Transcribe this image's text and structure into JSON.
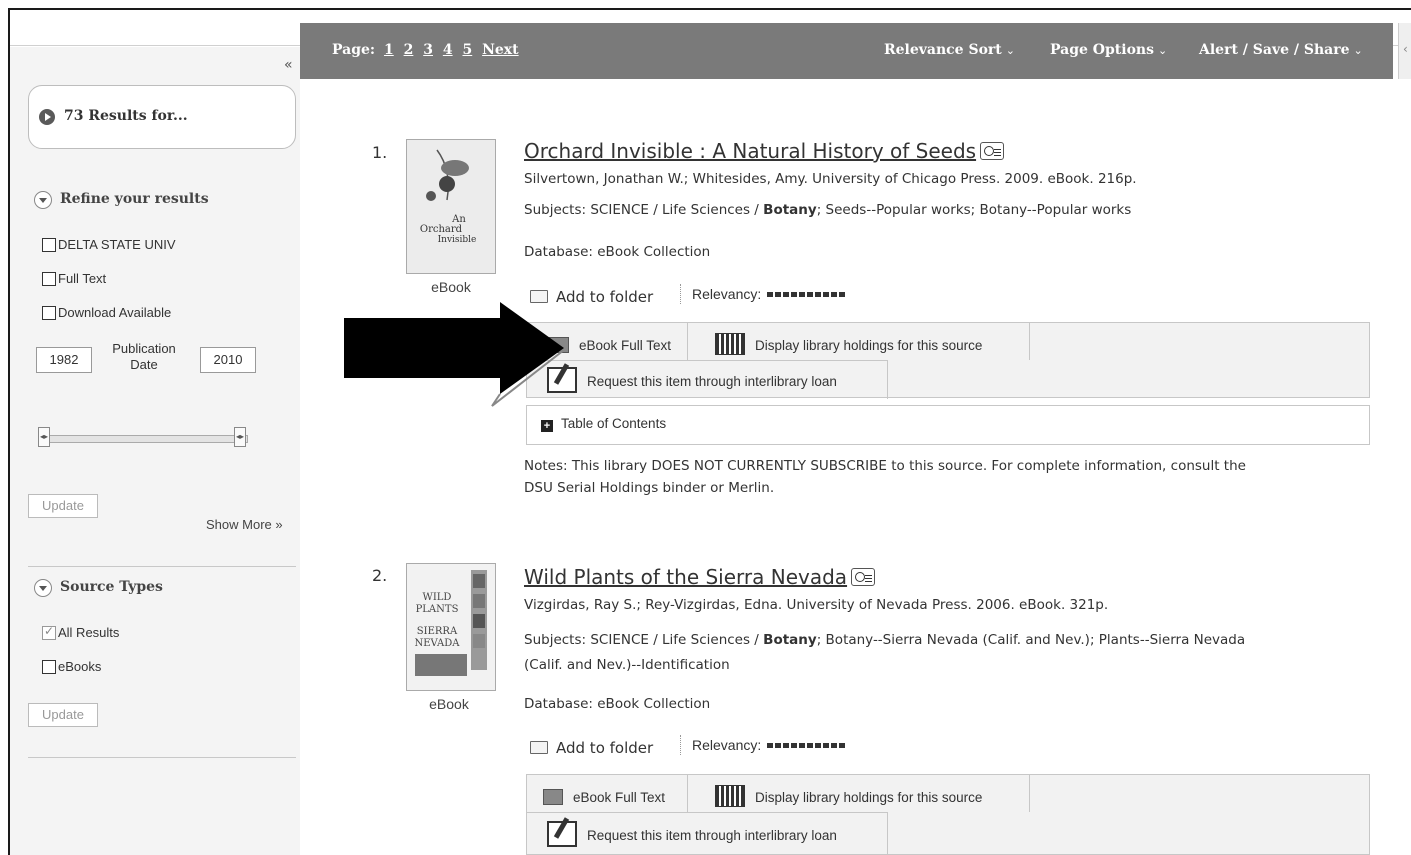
{
  "sidebar": {
    "collapse_icon": "«",
    "results_header": "73 Results for...",
    "refine_title": "Refine your results",
    "refine_options": [
      "DELTA STATE UNIV",
      "Full Text",
      "Download Available"
    ],
    "pub_date": {
      "from": "1982",
      "to": "2010",
      "label": "Publication Date"
    },
    "update_label": "Update",
    "show_more": "Show More »",
    "source_types_title": "Source Types",
    "source_options": [
      {
        "label": "All Results",
        "checked": true
      },
      {
        "label": "eBooks",
        "checked": false
      }
    ],
    "update_label_2": "Update"
  },
  "toolbar": {
    "page_label": "Page:",
    "pages": [
      "1",
      "2",
      "3",
      "4",
      "5"
    ],
    "next_label": "Next",
    "sort_label": "Relevance Sort",
    "page_options_label": "Page Options",
    "alert_label": "Alert / Save / Share",
    "chevron": "⌄",
    "right_edge_icon": "‹"
  },
  "results": [
    {
      "number": "1.",
      "type_label": "eBook",
      "title": "Orchard Invisible : A Natural History of Seeds",
      "authors": "Silvertown, Jonathan W.; Whitesides, Amy. University of Chicago Press. 2009. eBook. 216p.",
      "subjects_prefix": "Subjects: SCIENCE / Life Sciences / ",
      "subjects_bold": "Botany",
      "subjects_suffix": "; Seeds--Popular works; Botany--Popular works",
      "database": "Database: eBook Collection",
      "add_to_folder": "Add to folder",
      "relevancy_label": "Relevancy:",
      "full_text_link": "eBook Full Text",
      "holdings_link": "Display library holdings for this source",
      "ill_link": "Request this item through interlibrary loan",
      "toc_label": "Table of Contents",
      "notes_line1": "Notes:  This library DOES NOT CURRENTLY SUBSCRIBE to this source. For complete information, consult the",
      "notes_line2": "DSU Serial Holdings binder or Merlin.",
      "cover_text": [
        "An",
        "Orchard",
        "Invisible"
      ]
    },
    {
      "number": "2.",
      "type_label": "eBook",
      "title": "Wild Plants of the Sierra Nevada",
      "authors": "Vizgirdas, Ray S.; Rey-Vizgirdas, Edna. University of Nevada Press. 2006. eBook. 321p.",
      "subjects_prefix": "Subjects: SCIENCE / Life Sciences / ",
      "subjects_bold": "Botany",
      "subjects_suffix": "; Botany--Sierra Nevada (Calif. and Nev.); Plants--Sierra Nevada",
      "subjects_line2": "(Calif. and Nev.)--Identification",
      "database": "Database: eBook Collection",
      "add_to_folder": "Add to folder",
      "relevancy_label": "Relevancy:",
      "full_text_link": "eBook Full Text",
      "holdings_link": "Display library holdings for this source",
      "ill_link": "Request this item through interlibrary loan",
      "cover_text": [
        "WILD",
        "PLANTS",
        "SIERRA",
        "NEVADA"
      ]
    }
  ],
  "colors": {
    "toolbar": "#7a7a7a",
    "sidebar": "#f4f4f4",
    "arrow": "#000000"
  }
}
